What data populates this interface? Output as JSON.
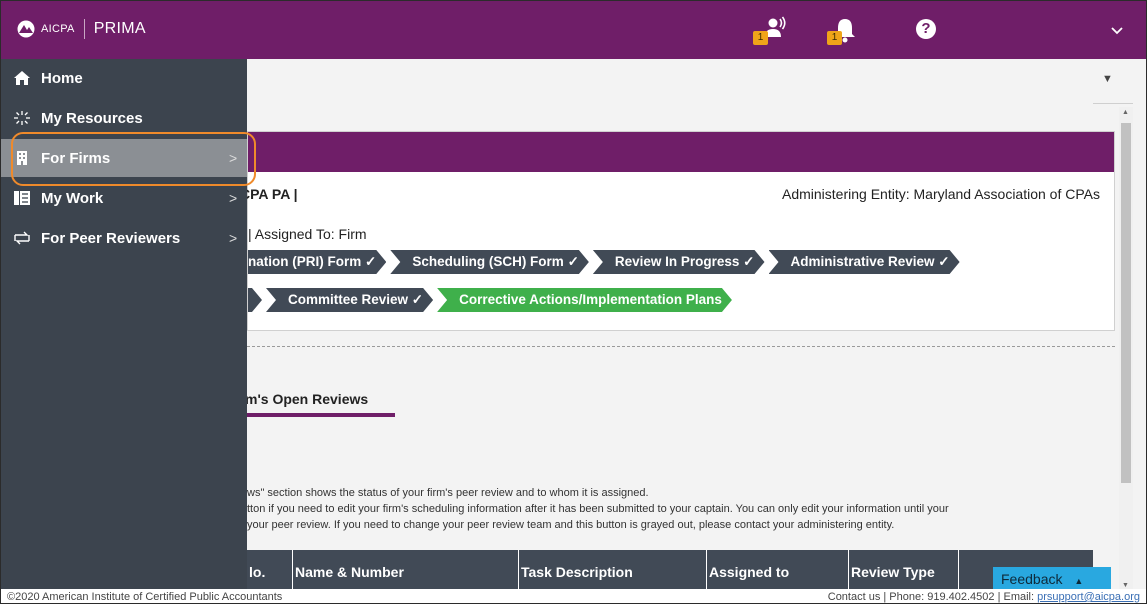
{
  "header": {
    "aicpa": "AICPA",
    "app_title": "PRIMA",
    "notification_badge_1": "1",
    "notification_badge_2": "1",
    "help_label": "?",
    "colors": {
      "primary": "#6f1e68",
      "badge": "#f0a419"
    }
  },
  "sidenav": {
    "items": [
      {
        "label": "Home",
        "icon": "home-icon",
        "arrow": ""
      },
      {
        "label": "My Resources",
        "icon": "sparkle-icon",
        "arrow": ""
      },
      {
        "label": "For Firms",
        "icon": "building-icon",
        "arrow": ">"
      },
      {
        "label": "My Work",
        "icon": "list-icon",
        "arrow": ">"
      },
      {
        "label": "For Peer Reviewers",
        "icon": "swap-icon",
        "arrow": ">"
      }
    ]
  },
  "main": {
    "firm_name": "CPA PA |",
    "admin_entity": "Administering Entity: Maryland Association of CPAs",
    "assigned_to": "| Assigned To: Firm",
    "steps_row1": [
      "nation (PRI) Form ✓",
      "Scheduling (SCH) Form ✓",
      "Review In Progress ✓",
      "Administrative Review ✓"
    ],
    "steps_row2": [
      "",
      "Committee Review ✓",
      "Corrective Actions/Implementation Plans"
    ],
    "tab_label": "m's Open Reviews",
    "description_lines": [
      "ws\" section shows the status of your firm's peer review and to whom it is assigned.",
      "tton if you need to edit your firm's scheduling information after it has been submitted to your captain. You can only edit your information until your",
      "your peer review. If you need to change your peer review team and this button is grayed out, please contact your administering entity."
    ],
    "table_headers": [
      "lo.",
      "Name & Number",
      "Task Description",
      "Assigned to",
      "Review Type",
      ""
    ],
    "feedback_label": "Feedback"
  },
  "footer": {
    "copyright": "©2020 American Institute of Certified Public Accountants",
    "contact": "Contact us | Phone: 919.402.4502 | Email: ",
    "email": "prsupport@aicpa.org"
  }
}
